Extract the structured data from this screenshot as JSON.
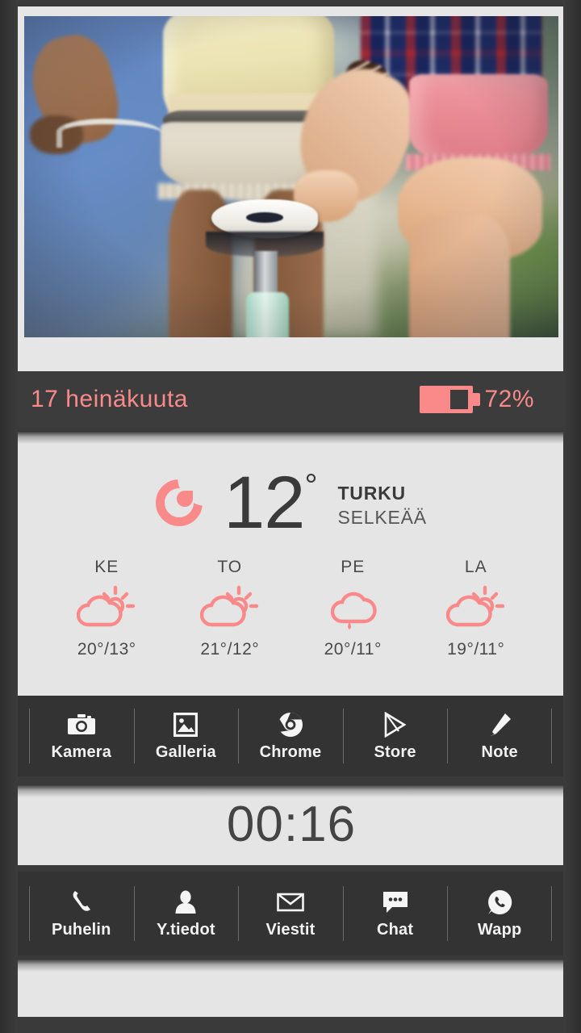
{
  "status": {
    "date": "17 heinäkuuta",
    "battery_percent": "72%",
    "battery_icon": "battery-icon",
    "accent_color": "#fa8a8a"
  },
  "wallpaper": {
    "name": "photo-wallpaper",
    "description": "Two women on bicycles photographed from behind, one in a yellow top with white cut-off denim shorts, one in a plaid shirt with pink shorts, blurred green and blue outdoor background"
  },
  "weather": {
    "condition_icon": "moon-icon",
    "temperature": "12",
    "degree": "°",
    "city": "TURKU",
    "condition": "SELKEÄÄ",
    "forecast": [
      {
        "day": "KE",
        "icon": "partly-cloudy-icon",
        "temps": "20°/13°",
        "high": "20°",
        "low": "13°"
      },
      {
        "day": "TO",
        "icon": "partly-cloudy-icon",
        "temps": "21°/12°",
        "high": "21°",
        "low": "12°"
      },
      {
        "day": "PE",
        "icon": "rain-cloud-icon",
        "temps": "20°/11°",
        "high": "20°",
        "low": "11°"
      },
      {
        "day": "LA",
        "icon": "partly-cloudy-icon",
        "temps": "19°/11°",
        "high": "19°",
        "low": "11°"
      }
    ]
  },
  "dock_top": {
    "items": [
      {
        "label": "Kamera",
        "icon": "camera-icon"
      },
      {
        "label": "Galleria",
        "icon": "image-icon"
      },
      {
        "label": "Chrome",
        "icon": "chrome-icon"
      },
      {
        "label": "Store",
        "icon": "play-store-icon"
      },
      {
        "label": "Note",
        "icon": "pencil-icon"
      }
    ]
  },
  "clock": {
    "time": "00:16"
  },
  "dock_bottom": {
    "items": [
      {
        "label": "Puhelin",
        "icon": "phone-handset-icon"
      },
      {
        "label": "Y.tiedot",
        "icon": "contact-person-icon"
      },
      {
        "label": "Viestit",
        "icon": "envelope-icon"
      },
      {
        "label": "Chat",
        "icon": "chat-bubble-icon"
      },
      {
        "label": "Wapp",
        "icon": "whatsapp-icon"
      }
    ]
  }
}
